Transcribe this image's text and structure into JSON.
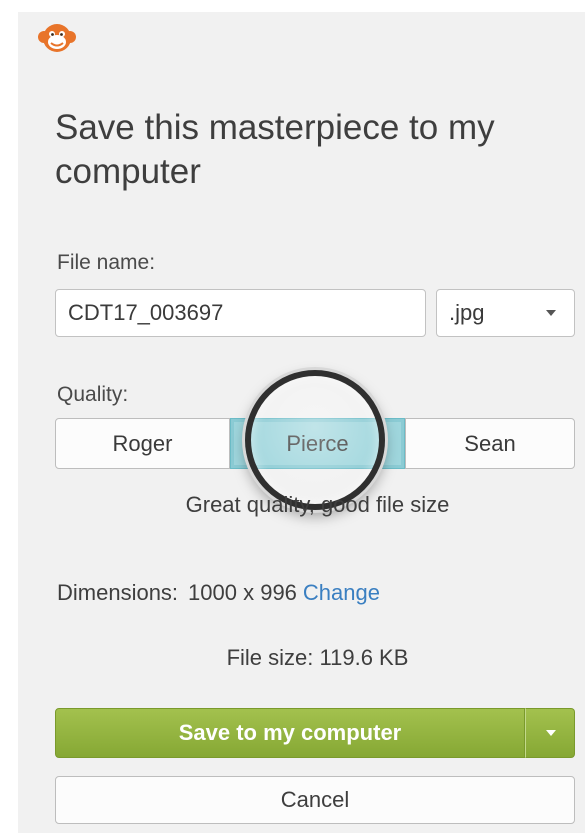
{
  "header": {
    "logo_icon": "monkey-logo-icon",
    "title": "Save this masterpiece to my computer"
  },
  "file": {
    "label": "File name:",
    "name_value": "CDT17_003697",
    "type_value": ".jpg",
    "type_icon": "chevron-down-icon"
  },
  "quality": {
    "label": "Quality:",
    "options": [
      "Roger",
      "Pierce",
      "Sean"
    ],
    "selected": "Pierce",
    "description": "Great quality, good file size"
  },
  "dimensions": {
    "label": "Dimensions:",
    "value": "1000 x 996",
    "change_link": "Change"
  },
  "filesize": {
    "text": "File size: 119.6 KB"
  },
  "actions": {
    "save_label": "Save to my computer",
    "save_dropdown_icon": "chevron-down-icon",
    "cancel_label": "Cancel"
  },
  "colors": {
    "accent_green": "#8fb03c",
    "selected_teal": "#9fd6dd",
    "link_blue": "#3a7fc1",
    "logo_orange": "#e8742a"
  }
}
